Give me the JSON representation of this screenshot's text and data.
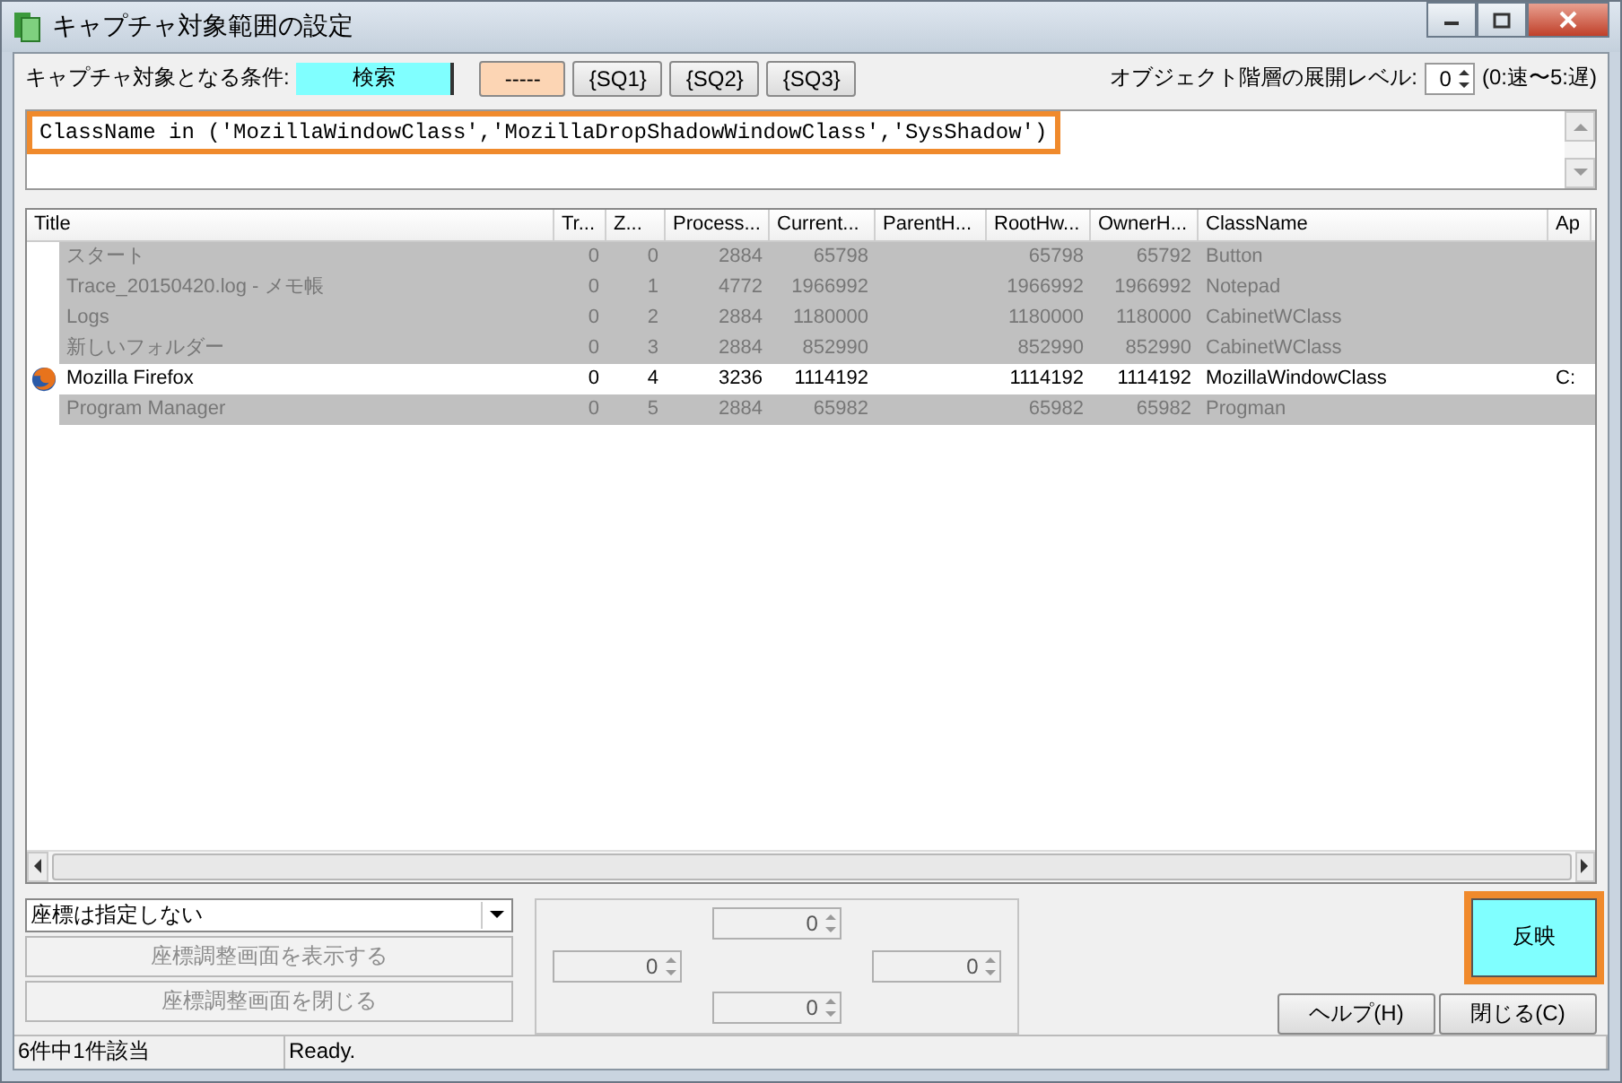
{
  "window": {
    "title": "キャプチャ対象範囲の設定"
  },
  "condition": {
    "label": "キャプチャ対象となる条件:",
    "search_button": "検索",
    "mode_button": "-----",
    "query_buttons": [
      "{SQ1}",
      "{SQ2}",
      "{SQ3}"
    ]
  },
  "depth": {
    "label": "オブジェクト階層の展開レベル:",
    "value": "0",
    "hint": "(0:速〜5:遅)"
  },
  "query": {
    "value": "ClassName in ('MozillaWindowClass','MozillaDropShadowWindowClass','SysShadow')",
    "highlighted": true
  },
  "table": {
    "columns": [
      "Title",
      "Tr...",
      "Z...",
      "Process...",
      "Current...",
      "ParentH...",
      "RootHw...",
      "OwnerH...",
      "ClassName",
      "Ap"
    ],
    "rows": [
      {
        "matched": false,
        "icon": false,
        "cells": [
          "スタート",
          "0",
          "0",
          "2884",
          "65798",
          "",
          "65798",
          "65792",
          "Button",
          ""
        ]
      },
      {
        "matched": false,
        "icon": false,
        "cells": [
          "Trace_20150420.log - メモ帳",
          "0",
          "1",
          "4772",
          "1966992",
          "",
          "1966992",
          "1966992",
          "Notepad",
          ""
        ]
      },
      {
        "matched": false,
        "icon": false,
        "cells": [
          "Logs",
          "0",
          "2",
          "2884",
          "1180000",
          "",
          "1180000",
          "1180000",
          "CabinetWClass",
          ""
        ]
      },
      {
        "matched": false,
        "icon": false,
        "cells": [
          "新しいフォルダー",
          "0",
          "3",
          "2884",
          "852990",
          "",
          "852990",
          "852990",
          "CabinetWClass",
          ""
        ]
      },
      {
        "matched": true,
        "icon": true,
        "cells": [
          "Mozilla Firefox",
          "0",
          "4",
          "3236",
          "1114192",
          "",
          "1114192",
          "1114192",
          "MozillaWindowClass",
          "C:"
        ]
      },
      {
        "matched": false,
        "icon": false,
        "cells": [
          "Program Manager",
          "0",
          "5",
          "2884",
          "65982",
          "",
          "65982",
          "65982",
          "Progman",
          ""
        ]
      }
    ]
  },
  "coordinates": {
    "mode": "座標は指定しない",
    "show_button": "座標調整画面を表示する",
    "close_button": "座標調整画面を閉じる",
    "spinners": [
      "0",
      "0",
      "0",
      "0"
    ]
  },
  "buttons": {
    "apply": "反映",
    "apply_highlighted": true,
    "help": "ヘルプ(H)",
    "close": "閉じる(C)"
  },
  "status_bar": [
    "6件中1件該当",
    "Ready."
  ]
}
